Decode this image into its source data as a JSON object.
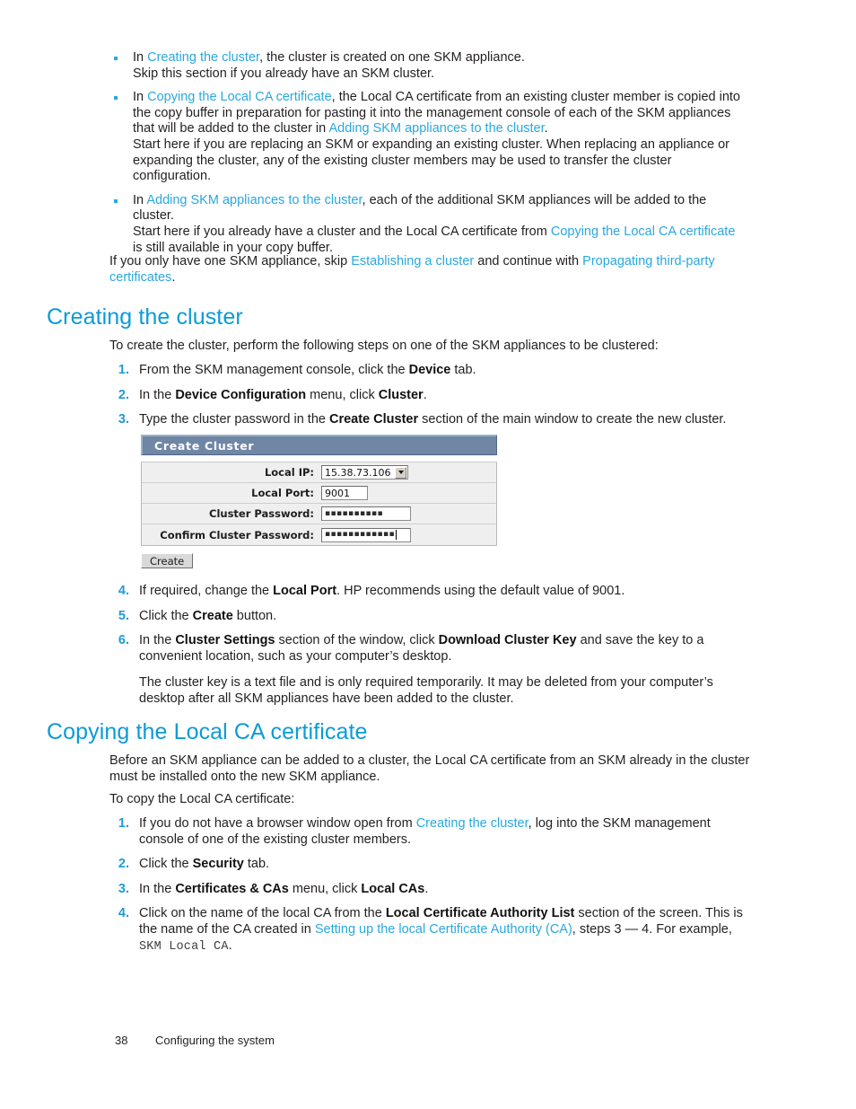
{
  "page": {
    "number": "38",
    "footer_title": "Configuring the system"
  },
  "intro_bullets": [
    {
      "segments": [
        {
          "t": "In ",
          "k": "plain"
        },
        {
          "t": "Creating the cluster",
          "k": "link"
        },
        {
          "t": ", the cluster is created on one SKM appliance.",
          "k": "plain"
        },
        {
          "t": "\n",
          "k": "br"
        },
        {
          "t": "Skip this section if you already have an SKM cluster.",
          "k": "plain"
        }
      ]
    },
    {
      "segments": [
        {
          "t": "In ",
          "k": "plain"
        },
        {
          "t": "Copying the Local CA certificate",
          "k": "link"
        },
        {
          "t": ", the Local CA certificate from an existing cluster member is copied into the copy buffer in preparation for pasting it into the management console of each of the SKM appliances that will be added to the cluster in ",
          "k": "plain"
        },
        {
          "t": "Adding SKM appliances to the cluster",
          "k": "link"
        },
        {
          "t": ".",
          "k": "plain"
        },
        {
          "t": "\n",
          "k": "br"
        },
        {
          "t": "Start here if you are replacing an SKM or expanding an existing cluster.  When replacing an appliance or expanding the cluster, any of the existing cluster members may be used to transfer the cluster configuration.",
          "k": "plain"
        }
      ]
    },
    {
      "segments": [
        {
          "t": "In ",
          "k": "plain"
        },
        {
          "t": "Adding SKM appliances to the cluster",
          "k": "link"
        },
        {
          "t": ", each of the additional SKM appliances will be added to the cluster.",
          "k": "plain"
        },
        {
          "t": "\n",
          "k": "br"
        },
        {
          "t": "Start here if you already have a cluster and the Local CA certificate from ",
          "k": "plain"
        },
        {
          "t": "Copying the Local CA certificate",
          "k": "link"
        },
        {
          "t": " is still available in your copy buffer.",
          "k": "plain"
        }
      ]
    }
  ],
  "intro_paragraph": {
    "segments": [
      {
        "t": "If you only have one SKM appliance, skip ",
        "k": "plain"
      },
      {
        "t": "Establishing a cluster",
        "k": "link"
      },
      {
        "t": " and continue with ",
        "k": "plain"
      },
      {
        "t": "Propagating third-party certificates",
        "k": "link"
      },
      {
        "t": ".",
        "k": "plain"
      }
    ]
  },
  "section_creating": {
    "heading": "Creating the cluster",
    "lead_in": "To create the cluster, perform the following steps on one of the SKM appliances to be clustered:",
    "steps": [
      {
        "number": "1.",
        "segments": [
          {
            "t": "From the SKM management console, click the ",
            "k": "plain"
          },
          {
            "t": "Device",
            "k": "bold"
          },
          {
            "t": " tab.",
            "k": "plain"
          }
        ]
      },
      {
        "number": "2.",
        "segments": [
          {
            "t": "In the ",
            "k": "plain"
          },
          {
            "t": "Device Configuration",
            "k": "bold"
          },
          {
            "t": " menu, click ",
            "k": "plain"
          },
          {
            "t": "Cluster",
            "k": "bold"
          },
          {
            "t": ".",
            "k": "plain"
          }
        ]
      },
      {
        "number": "3.",
        "segments": [
          {
            "t": "Type the cluster password in the ",
            "k": "plain"
          },
          {
            "t": "Create Cluster",
            "k": "bold"
          },
          {
            "t": " section of the main window to create the new cluster.",
            "k": "plain"
          }
        ]
      }
    ],
    "steps_after_figure": [
      {
        "number": "4.",
        "segments": [
          {
            "t": "If required, change the ",
            "k": "plain"
          },
          {
            "t": "Local Port",
            "k": "bold"
          },
          {
            "t": ".  HP recommends using the default value of 9001.",
            "k": "plain"
          }
        ]
      },
      {
        "number": "5.",
        "segments": [
          {
            "t": "Click the ",
            "k": "plain"
          },
          {
            "t": "Create",
            "k": "bold"
          },
          {
            "t": " button.",
            "k": "plain"
          }
        ]
      },
      {
        "number": "6.",
        "segments": [
          {
            "t": "In the ",
            "k": "plain"
          },
          {
            "t": "Cluster Settings",
            "k": "bold"
          },
          {
            "t": " section of the window, click ",
            "k": "plain"
          },
          {
            "t": "Download Cluster Key",
            "k": "bold"
          },
          {
            "t": " and save the key to a convenient location, such as your computer’s desktop.",
            "k": "plain"
          }
        ],
        "sub_paragraph": "The cluster key is a text file and is only required temporarily.  It may be deleted from your computer’s desktop after all SKM appliances have been added to the cluster."
      }
    ]
  },
  "create_cluster_figure": {
    "title": "Create Cluster",
    "title_bar_color": "#6f87a5",
    "rows": [
      {
        "label": "Local IP:",
        "control": "combobox",
        "value": "15.38.73.106"
      },
      {
        "label": "Local Port:",
        "control": "textbox",
        "value": "9001"
      },
      {
        "label": "Cluster Password:",
        "control": "password",
        "value": "▪▪▪▪▪▪▪▪▪▪",
        "masked_count": 10
      },
      {
        "label": "Confirm Cluster Password:",
        "control": "password",
        "value": "▪▪▪▪▪▪▪▪▪▪▪▪",
        "masked_count": 12,
        "focused": true
      }
    ],
    "button_label": "Create"
  },
  "section_copying": {
    "heading": "Copying the Local CA certificate",
    "paragraph_1": "Before an SKM appliance can be added to a cluster, the Local CA certificate from an SKM already in the cluster must be installed onto the new SKM appliance.",
    "paragraph_2": "To copy the Local CA certificate:",
    "steps": [
      {
        "number": "1.",
        "segments": [
          {
            "t": "If you do not have a browser window open from ",
            "k": "plain"
          },
          {
            "t": "Creating the cluster",
            "k": "link"
          },
          {
            "t": ", log into the SKM management console of one of the existing cluster members.",
            "k": "plain"
          }
        ]
      },
      {
        "number": "2.",
        "segments": [
          {
            "t": "Click the ",
            "k": "plain"
          },
          {
            "t": "Security",
            "k": "bold"
          },
          {
            "t": " tab.",
            "k": "plain"
          }
        ]
      },
      {
        "number": "3.",
        "segments": [
          {
            "t": "In the ",
            "k": "plain"
          },
          {
            "t": "Certificates & CAs",
            "k": "bold"
          },
          {
            "t": " menu, click ",
            "k": "plain"
          },
          {
            "t": "Local CAs",
            "k": "bold"
          },
          {
            "t": ".",
            "k": "plain"
          }
        ]
      },
      {
        "number": "4.",
        "segments": [
          {
            "t": "Click on the name of the local CA from the ",
            "k": "plain"
          },
          {
            "t": "Local Certificate Authority List",
            "k": "bold"
          },
          {
            "t": " section of the screen.  This is the name of the CA created in ",
            "k": "plain"
          },
          {
            "t": "Setting up the local Certificate Authority (CA)",
            "k": "link"
          },
          {
            "t": ", steps 3 — 4.  For example, ",
            "k": "plain"
          },
          {
            "t": "SKM Local CA",
            "k": "mono"
          },
          {
            "t": ".",
            "k": "plain"
          }
        ]
      }
    ]
  },
  "colors": {
    "link": "#29a8df",
    "heading": "#0b9bd7",
    "step_number": "#1f9ad6",
    "bullet": "#29a8df",
    "body": "#231f20"
  }
}
